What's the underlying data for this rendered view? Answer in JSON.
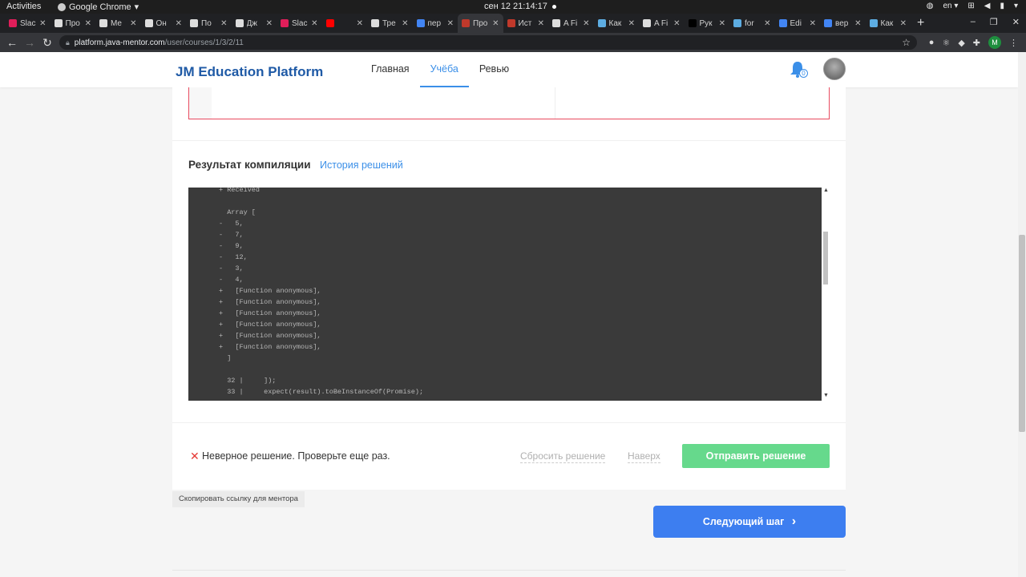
{
  "os_bar": {
    "activities": "Activities",
    "app_name": "Google Chrome",
    "app_caret": "▾",
    "clock": "сен 12  21:14:17",
    "lang": "en ▾"
  },
  "tabs": [
    {
      "label": "Slac",
      "color": "#e01e5a"
    },
    {
      "label": "Про",
      "color": "#dddddd"
    },
    {
      "label": "Me",
      "color": "#dddddd"
    },
    {
      "label": "Он",
      "color": "#dddddd"
    },
    {
      "label": "По",
      "color": "#dddddd"
    },
    {
      "label": "Дж",
      "color": "#dddddd"
    },
    {
      "label": "Slac",
      "color": "#e01e5a"
    },
    {
      "label": "",
      "color": "#ff0000"
    },
    {
      "label": "Тре",
      "color": "#dddddd"
    },
    {
      "label": "пер",
      "color": "#4285f4"
    },
    {
      "label": "Про",
      "color": "#c0392b"
    },
    {
      "label": "Ист",
      "color": "#c0392b"
    },
    {
      "label": "A Fi",
      "color": "#dddddd"
    },
    {
      "label": "Как",
      "color": "#5dade2"
    },
    {
      "label": "A Fi",
      "color": "#dddddd"
    },
    {
      "label": "Рук",
      "color": "#000000"
    },
    {
      "label": "for",
      "color": "#5dade2"
    },
    {
      "label": "Edi",
      "color": "#4285f4"
    },
    {
      "label": "вер",
      "color": "#4285f4"
    },
    {
      "label": "Как",
      "color": "#5dade2"
    }
  ],
  "tab_new": "+",
  "address": {
    "host": "platform.java-mentor.com",
    "path": "/user/courses/1/3/2/11"
  },
  "site": {
    "logo": "JM Education Platform",
    "nav": [
      "Главная",
      "Учёба",
      "Ревью"
    ],
    "active_nav": "Учёба",
    "notifications_count": "0"
  },
  "compilation": {
    "title": "Результат компиляции",
    "history_link": "История решений",
    "output_lines": [
      "+ Received",
      "",
      "  Array [",
      "-   5,",
      "-   7,",
      "-   9,",
      "-   12,",
      "-   3,",
      "-   4,",
      "+   [Function anonymous],",
      "+   [Function anonymous],",
      "+   [Function anonymous],",
      "+   [Function anonymous],",
      "+   [Function anonymous],",
      "+   [Function anonymous],",
      "  ]",
      "",
      "  32 |     ]);",
      "  33 |     expect(result).toBeInstanceOf(Promise);"
    ]
  },
  "result": {
    "error_icon": "✕",
    "error_text": "Неверное решение. Проверьте еще раз.",
    "reset_label": "Сбросить решение",
    "up_label": "Наверх",
    "submit_label": "Отправить решение"
  },
  "copy_link_label": "Скопировать ссылку для ментора",
  "next_step_label": "Следующий шаг",
  "next_step_chevron": "›"
}
